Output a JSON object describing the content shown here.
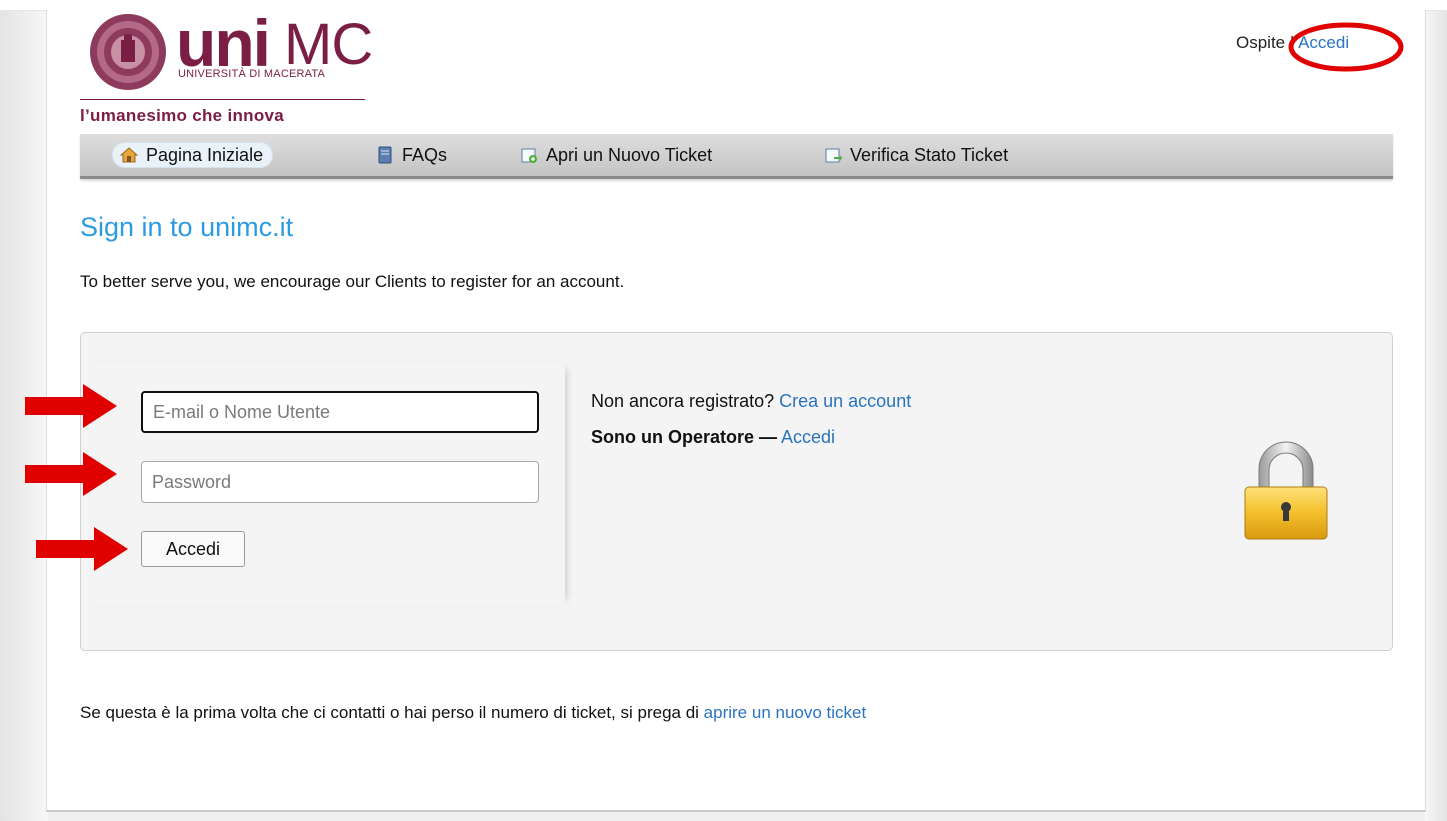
{
  "header": {
    "logo_main": "uni",
    "logo_accent": "MC",
    "logo_subtitle": "UNIVERSITÀ DI MACERATA",
    "tagline": "l’umanesimo che innova",
    "user_label": "Ospite",
    "separator": " | ",
    "login_link": "Accedi"
  },
  "nav": {
    "items": [
      {
        "label": "Pagina Iniziale",
        "icon": "home-icon",
        "active": true
      },
      {
        "label": "FAQs",
        "icon": "book-icon"
      },
      {
        "label": "Apri un Nuovo Ticket",
        "icon": "new-ticket-icon"
      },
      {
        "label": "Verifica Stato Ticket",
        "icon": "ticket-status-icon"
      }
    ]
  },
  "main": {
    "title": "Sign in to unimc.it",
    "intro": "To better serve you, we encourage our Clients to register for an account."
  },
  "login": {
    "username_placeholder": "E-mail o Nome Utente",
    "password_placeholder": "Password",
    "submit_label": "Accedi",
    "register_prompt": "Non ancora registrato?",
    "register_link": "Crea un account",
    "operator_label": "Sono un Operatore —",
    "operator_link": "Accedi"
  },
  "footer": {
    "text": "Se questa è la prima volta che ci contatti o hai perso il numero di ticket, si prega di",
    "link": "aprire un nuovo ticket"
  },
  "colors": {
    "brand": "#7a1f43",
    "link": "#2a73c0",
    "title": "#2d9be0",
    "annotation": "#e00000"
  }
}
